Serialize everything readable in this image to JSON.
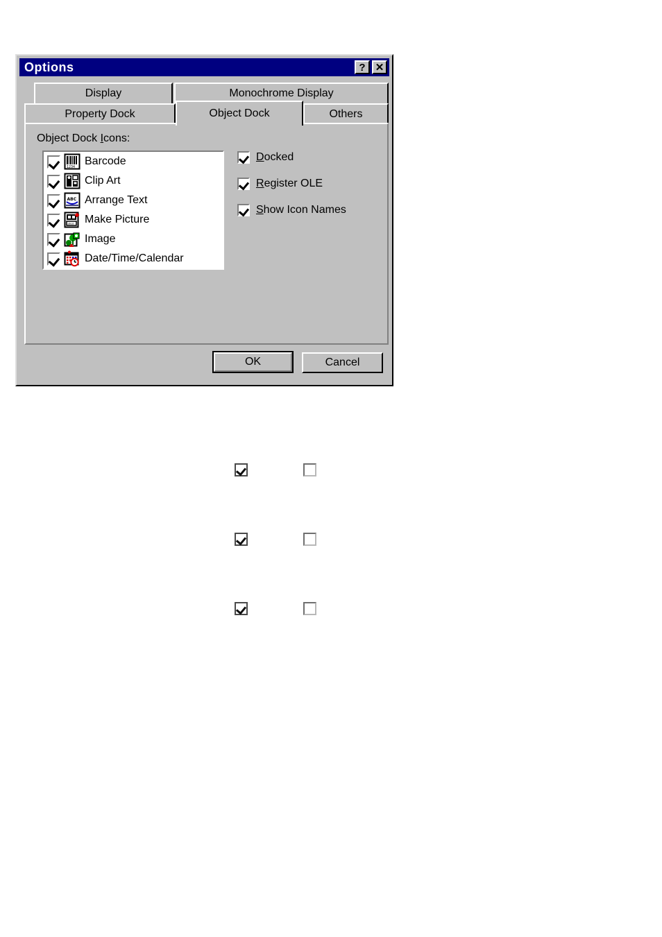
{
  "dialog": {
    "title": "Options",
    "titlebar_buttons": [
      {
        "name": "help-button",
        "glyph": "?"
      },
      {
        "name": "close-button",
        "glyph": "✕"
      }
    ],
    "tabs_row1": [
      {
        "label": "Display",
        "selected": false
      },
      {
        "label": "Monochrome Display",
        "selected": false
      }
    ],
    "tabs_row2": [
      {
        "label": "Property Dock",
        "selected": false
      },
      {
        "label": "Object Dock",
        "selected": true
      },
      {
        "label": "Others",
        "selected": false
      }
    ],
    "group_label_pre": "Object Dock ",
    "group_label_accel": "I",
    "group_label_post": "cons:",
    "icon_list": [
      {
        "label": "Barcode",
        "checked": true,
        "icon": "barcode-icon"
      },
      {
        "label": "Clip Art",
        "checked": true,
        "icon": "clip-art-icon"
      },
      {
        "label": "Arrange Text",
        "checked": true,
        "icon": "arrange-text-icon"
      },
      {
        "label": "Make Picture",
        "checked": true,
        "icon": "make-picture-icon"
      },
      {
        "label": "Image",
        "checked": true,
        "icon": "image-icon"
      },
      {
        "label": "Date/Time/Calendar",
        "checked": true,
        "icon": "date-time-calendar-icon"
      }
    ],
    "options": [
      {
        "accel": "D",
        "rest": "ocked",
        "checked": true,
        "name": "docked"
      },
      {
        "accel": "R",
        "rest": "egister OLE",
        "checked": true,
        "name": "register-ole"
      },
      {
        "accel": "S",
        "rest": "how Icon Names",
        "checked": true,
        "name": "show-icon-names"
      }
    ],
    "buttons": {
      "ok": "OK",
      "cancel": "Cancel"
    }
  },
  "loose_checkbox_rows": [
    {
      "left_checked": true,
      "right_checked": false
    },
    {
      "left_checked": true,
      "right_checked": false
    },
    {
      "left_checked": true,
      "right_checked": false
    }
  ],
  "colors": {
    "dialog_face": "#c0c0c0",
    "titlebar": "#000080",
    "titlebar_text": "#ffffff",
    "listbox_bg": "#ffffff",
    "shadow": "#808080",
    "highlight": "#ffffff",
    "page_bg": "#ffffff"
  }
}
